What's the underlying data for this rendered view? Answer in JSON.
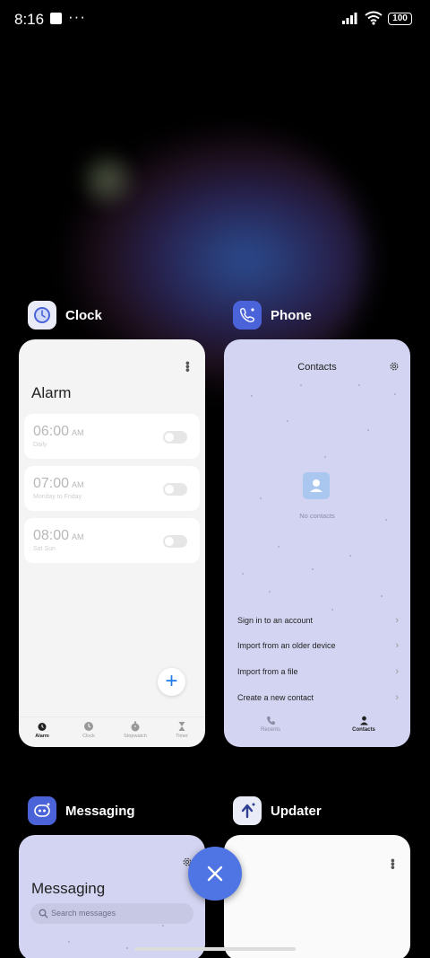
{
  "status_bar": {
    "time": "8:16",
    "dots": "···",
    "battery": "100"
  },
  "recents": [
    {
      "app_name": "Clock",
      "icon": "alarm-clock-icon",
      "preview": {
        "title": "Alarm",
        "alarms": [
          {
            "time": "06:00",
            "ampm": "AM",
            "repeat": "Daily",
            "enabled": false
          },
          {
            "time": "07:00",
            "ampm": "AM",
            "repeat": "Monday to Friday",
            "enabled": false
          },
          {
            "time": "08:00",
            "ampm": "AM",
            "repeat": "Sat Sun",
            "enabled": false
          }
        ],
        "tabs": [
          "Alarm",
          "Clock",
          "Stopwatch",
          "Timer"
        ],
        "active_tab": "Alarm"
      }
    },
    {
      "app_name": "Phone",
      "icon": "phone-app-icon",
      "preview": {
        "title": "Contacts",
        "empty_text": "No contacts",
        "options": [
          "Sign in to an account",
          "Import from an older device",
          "Import from a file",
          "Create a new contact"
        ],
        "tabs": [
          "Recents",
          "Contacts"
        ],
        "active_tab": "Contacts"
      }
    },
    {
      "app_name": "Messaging",
      "icon": "messaging-app-icon",
      "preview": {
        "title": "Messaging",
        "search_placeholder": "Search messages"
      }
    },
    {
      "app_name": "Updater",
      "icon": "updater-app-icon",
      "preview": {}
    }
  ],
  "colors": {
    "accent": "#4f74e3",
    "app_icon_bg": "#4a63d9",
    "card_tint": "#d3d4f1"
  }
}
